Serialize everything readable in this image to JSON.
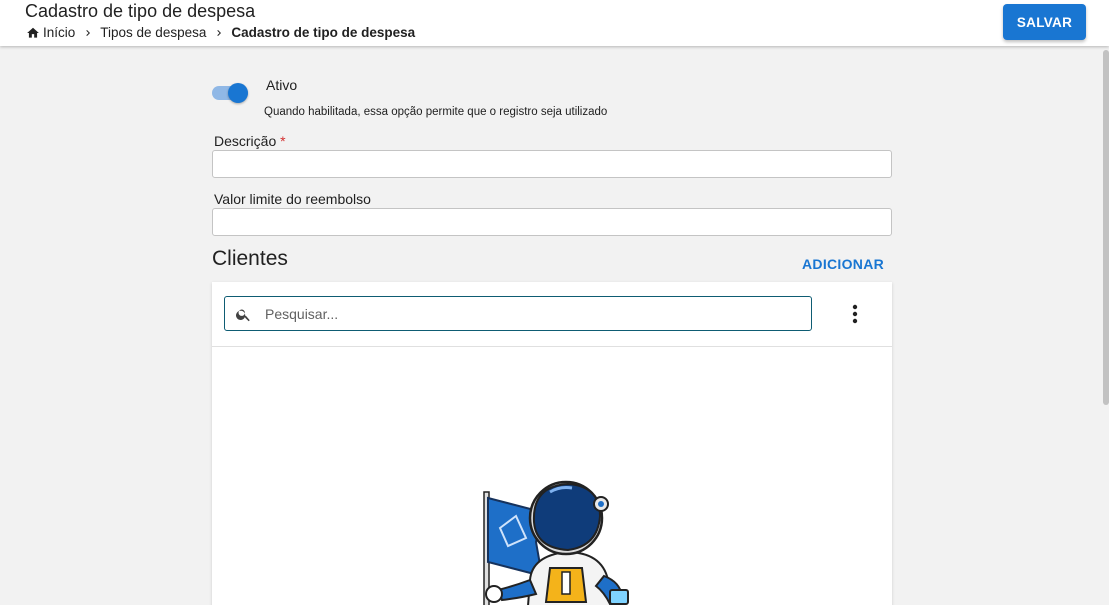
{
  "header": {
    "title": "Cadastro de tipo de despesa",
    "breadcrumb": [
      "Início",
      "Tipos de despesa",
      "Cadastro de tipo de despesa"
    ],
    "save_label": "SALVAR"
  },
  "form": {
    "active_toggle": {
      "label": "Ativo",
      "help": "Quando habilitada, essa opção permite que o registro seja utilizado",
      "checked": true
    },
    "description": {
      "label": "Descrição",
      "required_mark": "*",
      "value": ""
    },
    "reimbursement_limit": {
      "label": "Valor limite do reembolso",
      "value": ""
    }
  },
  "clients": {
    "title": "Clientes",
    "add_label": "ADICIONAR",
    "search_placeholder": "Pesquisar..."
  },
  "colors": {
    "primary": "#1976d2",
    "toggle_track": "#90b8e6",
    "required": "#d32f2f",
    "search_border": "#0e5c73"
  },
  "icons": [
    "home-icon",
    "chevron-right-icon",
    "search-icon",
    "more-vert-icon",
    "astronaut-mascot-icon"
  ]
}
